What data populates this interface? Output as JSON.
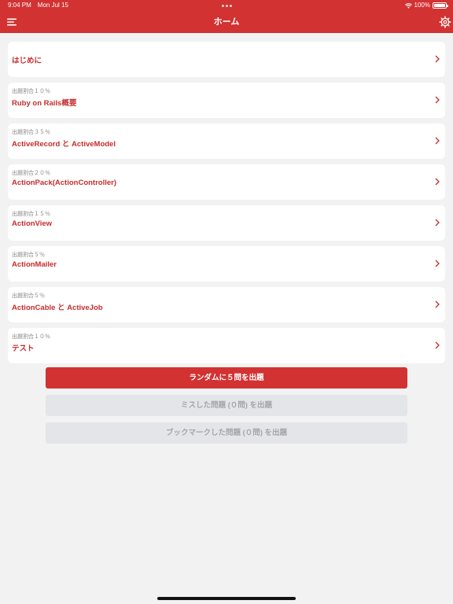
{
  "status_bar": {
    "time": "9:04 PM",
    "date": "Mon Jul 15",
    "battery": "100%"
  },
  "nav": {
    "title": "ホーム"
  },
  "sections": [
    {
      "ratio": "",
      "label": "はじめに"
    },
    {
      "ratio": "出題割合１０％",
      "label": "Ruby on Rails概要"
    },
    {
      "ratio": "出題割合３５％",
      "label": "ActiveRecord と ActiveModel"
    },
    {
      "ratio": "出題割合２０％",
      "label": "ActionPack(ActionController)"
    },
    {
      "ratio": "出題割合１５％",
      "label": "ActionView"
    },
    {
      "ratio": "出題割合５％",
      "label": "ActionMailer"
    },
    {
      "ratio": "出題割合５％",
      "label": "ActionCable と ActiveJob"
    },
    {
      "ratio": "出題割合１０％",
      "label": "テスト"
    }
  ],
  "buttons": {
    "random": "ランダムに５問を出題",
    "missed": "ミスした問題 (０問) を出題",
    "bookmarked": "ブックマークした問題 (０問) を出題"
  },
  "colors": {
    "accent": "#d23232",
    "label": "#c62c2c",
    "background": "#f2f2f2",
    "disabled_bg": "#e3e5e8",
    "disabled_text": "#a3a6aa"
  },
  "icons": {
    "menu": "menu-icon",
    "settings": "gear-icon",
    "wifi": "wifi-icon",
    "battery": "battery-icon",
    "chevron": "chevron-right-icon"
  }
}
